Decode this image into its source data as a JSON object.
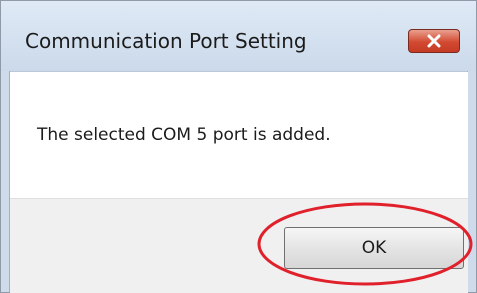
{
  "dialog": {
    "title": "Communication Port Setting",
    "message": "The selected COM 5 port is added.",
    "ok_label": "OK"
  },
  "icons": {
    "close": "close-icon"
  },
  "colors": {
    "titlebar": "#cbd9ea",
    "close_button": "#d34a32",
    "highlight": "#e0202a"
  }
}
